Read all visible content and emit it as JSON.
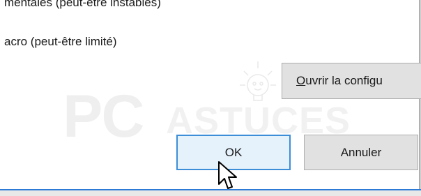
{
  "options": {
    "line1": "mentales (peut-être instables)",
    "line2": "acro (peut-être limité)"
  },
  "buttons": {
    "config_mnemonic": "O",
    "config_rest": "uvrir la configu",
    "ok_label": "OK",
    "cancel_label": "Annuler"
  },
  "watermark": {
    "pc": "PC",
    "astuces": "ASTUCES"
  },
  "colors": {
    "focus_border": "#3c8ed8",
    "focus_fill": "#e5f1fb",
    "button_fill": "#e1e1e1",
    "accent_bar": "#2b7bd6"
  }
}
